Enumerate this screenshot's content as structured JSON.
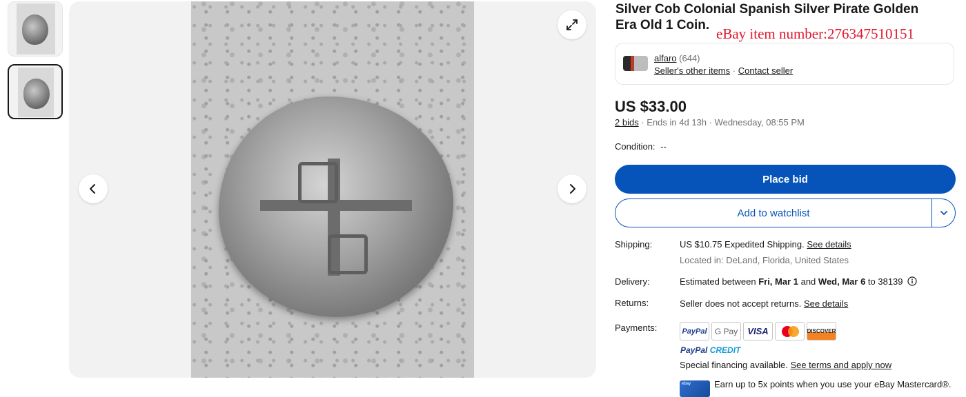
{
  "listing": {
    "title": "Silver Cob Colonial Spanish Silver Pirate Golden Era Old 1 Coin.",
    "watermark": "eBay item number:276347510151"
  },
  "seller": {
    "name": "alfaro",
    "feedback": "(644)",
    "other_items": "Seller's other items",
    "separator": "·",
    "contact": "Contact seller"
  },
  "pricing": {
    "price": "US $33.00",
    "bids": "2 bids",
    "ends": "· Ends in 4d 13h · Wednesday, 08:55 PM"
  },
  "condition": {
    "label": "Condition:",
    "value": "--"
  },
  "actions": {
    "place_bid": "Place bid",
    "watchlist": "Add to watchlist"
  },
  "shipping": {
    "label": "Shipping:",
    "price": "US $10.75",
    "method": " Expedited Shipping. ",
    "details": "See details",
    "location": "Located in: DeLand, Florida, United States"
  },
  "delivery": {
    "label": "Delivery:",
    "prefix": "Estimated between ",
    "start": "Fri, Mar 1",
    "middle": " and ",
    "end": "Wed, Mar 6",
    "suffix": " to 38139"
  },
  "returns": {
    "label": "Returns:",
    "text": "Seller does not accept returns. ",
    "details": "See details"
  },
  "payments": {
    "label": "Payments:",
    "icons": [
      "PayPal",
      "G Pay",
      "VISA",
      "Mastercard",
      "DISCOVER"
    ],
    "paypal_credit_a": "PayPal",
    "paypal_credit_b": " CREDIT",
    "financing": "Special financing available. ",
    "financing_link": "See terms and apply now",
    "card_label": "ebay",
    "earn": "Earn up to 5x points when you use your eBay Mastercard®."
  },
  "colors": {
    "primary_blue": "#0654ba",
    "watermark_red": "#e0152b"
  }
}
